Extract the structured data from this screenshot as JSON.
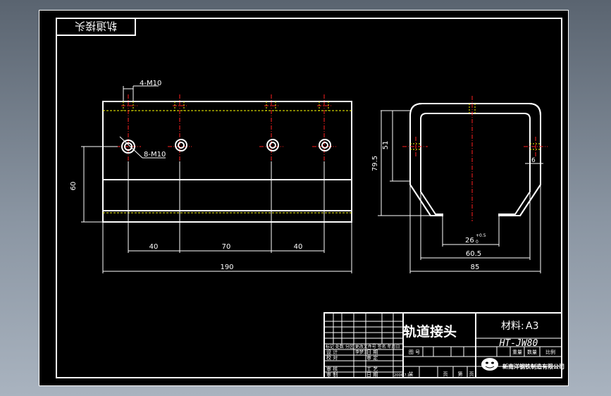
{
  "drawing": {
    "part_name": "轨道接头",
    "stamp_text": "轨道接头",
    "material_label": "材料:",
    "material_value": "A3",
    "drawing_number": "HT-JW80",
    "company": "新南洋钢铁制造有限公司"
  },
  "front_view": {
    "dims": {
      "thread_holes": "4-M10",
      "through_holes": "8-M10",
      "height": "60",
      "spacing_left": "40",
      "spacing_mid": "70",
      "spacing_right": "40",
      "overall_length": "190"
    }
  },
  "side_view": {
    "dims": {
      "inner_height": "51",
      "outer_height": "79.5",
      "hole_offset": "6",
      "slot_width": "26",
      "slot_tolerance_upper": "+0.5",
      "slot_tolerance_lower": "0",
      "inner_width": "60.5",
      "outer_width": "85"
    }
  },
  "title_block": {
    "revision_header": "标记 处数 分区 更改文件号 签名 年月日",
    "row_labels": [
      "设 计",
      "校 对",
      "审 核",
      "审 制"
    ],
    "designer": "李梦三",
    "date_labels": [
      "日 期",
      "审 定",
      "工 艺",
      "日 期"
    ],
    "date_value": "2006.7.18",
    "column_headers": [
      "图 号",
      "重量",
      "数量",
      "比例"
    ],
    "footer_labels": [
      "共",
      "页",
      "第",
      "页"
    ]
  },
  "colors": {
    "line": "#ffffff",
    "centerline": "#ff2020",
    "hidden": "#ffff00",
    "background": "#000000"
  }
}
